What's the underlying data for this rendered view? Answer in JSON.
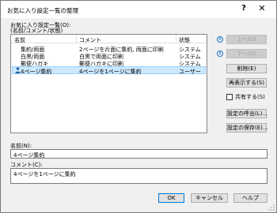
{
  "window": {
    "title": "お気に入り設定一覧の整理",
    "help_glyph": "?",
    "close_glyph": "✕"
  },
  "list": {
    "label": "お気に入り設定一覧(O):",
    "sublabel": "(名前/コメント/状態)",
    "columns": [
      "名前",
      "コメント",
      "状態"
    ],
    "rows": [
      {
        "name": "集約/両面",
        "comment": "2ページを片面に集約, 両面に印刷",
        "state": "システム",
        "selected": false
      },
      {
        "name": "白黒/両面",
        "comment": "白黒で両面に印刷",
        "state": "システム",
        "selected": false
      },
      {
        "name": "郵便ハガキ",
        "comment": "郵便ハガキに印刷",
        "state": "システム",
        "selected": false
      },
      {
        "name": "4ページ集約",
        "comment": "4ページを1ページに集約",
        "state": "ユーザー",
        "selected": true
      }
    ]
  },
  "side": {
    "info_glyph": "i",
    "up_label": "上へ(U)",
    "down_label": "下へ(D)",
    "delete_label": "削除(E)",
    "redisplay_label": "再表示する(S)",
    "share_label": "共有する(S)",
    "load_label": "設定の呼出(L)...",
    "save_label": "設定の保存(E)..."
  },
  "name_field": {
    "label": "名前(N):",
    "value": "4ページ集約"
  },
  "comment_field": {
    "label": "コメント(C):",
    "value": "4ページを1ページに集約"
  },
  "footer": {
    "ok_label": "OK",
    "cancel_label": "キャンセル",
    "help_label": "ヘルプ"
  },
  "colors": {
    "selection": "#cce8ff",
    "accent": "#0078d7",
    "info": "#1a73c8"
  }
}
